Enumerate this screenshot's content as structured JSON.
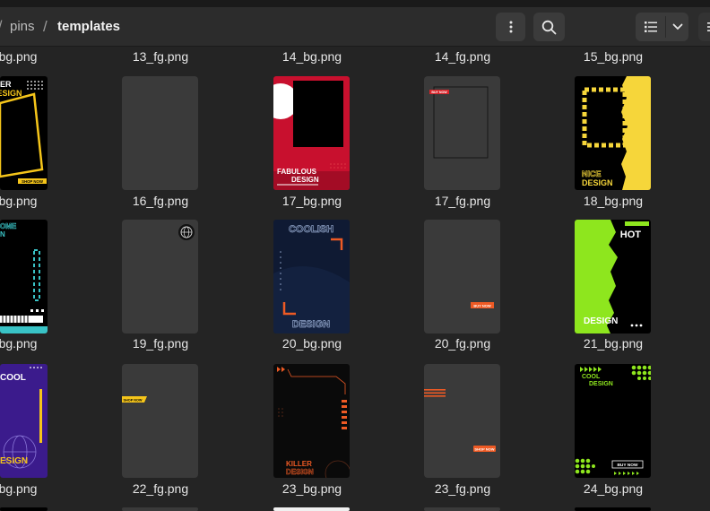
{
  "header": {
    "crumb_sep": "/",
    "crumb_parent": "pins",
    "crumb_current": "templates",
    "icons": [
      "more-vertical-icon",
      "search-icon",
      "list-view-icon",
      "chevron-down-icon",
      "hamburger-icon"
    ]
  },
  "colors": {
    "bg": "#242424",
    "tile": "#3a3a3a",
    "header": "#2c2c2c"
  },
  "files": {
    "row0": [
      "bg.png",
      "13_fg.png",
      "14_bg.png",
      "14_fg.png",
      "15_bg.png"
    ],
    "row1": [
      "bg.png",
      "16_fg.png",
      "17_bg.png",
      "17_fg.png",
      "18_bg.png"
    ],
    "row2": [
      "bg.png",
      "19_fg.png",
      "20_bg.png",
      "20_fg.png",
      "21_bg.png"
    ],
    "row3": [
      "bg.png",
      "22_fg.png",
      "23_bg.png",
      "23_fg.png",
      "24_bg.png"
    ]
  },
  "thumb_text": {
    "t_a1_top": "ER",
    "t_a1_mid": "DESIGN",
    "t_a1_btn": "SHOP NOW",
    "t_a2_top": "OME",
    "t_a2_mid": "N",
    "t_a3_top": "COOL",
    "t_a3_bottom": "ESIGN",
    "t_17_l1": "FABULOUS",
    "t_17_l2": "DESIGN",
    "t_17fg_tag": "BUY NOW",
    "t_18_l1": "NICE",
    "t_18_l2": "DESIGN",
    "t_20_top": "COOLISH",
    "t_20_bottom": "DESIGN",
    "t_20fg_btn": "BUY NOW",
    "t_21_top": "HOT",
    "t_21_bottom": "DESIGN",
    "t_22fg_tag": "SHOP NOW",
    "t_23_l1": "KILLER",
    "t_23_l2": "DESIGN",
    "t_23fg_btn": "SHOP NOW",
    "t_24_l1": "COOL",
    "t_24_l2": "DESIGN",
    "t_24_btn": "BUY NOW"
  }
}
